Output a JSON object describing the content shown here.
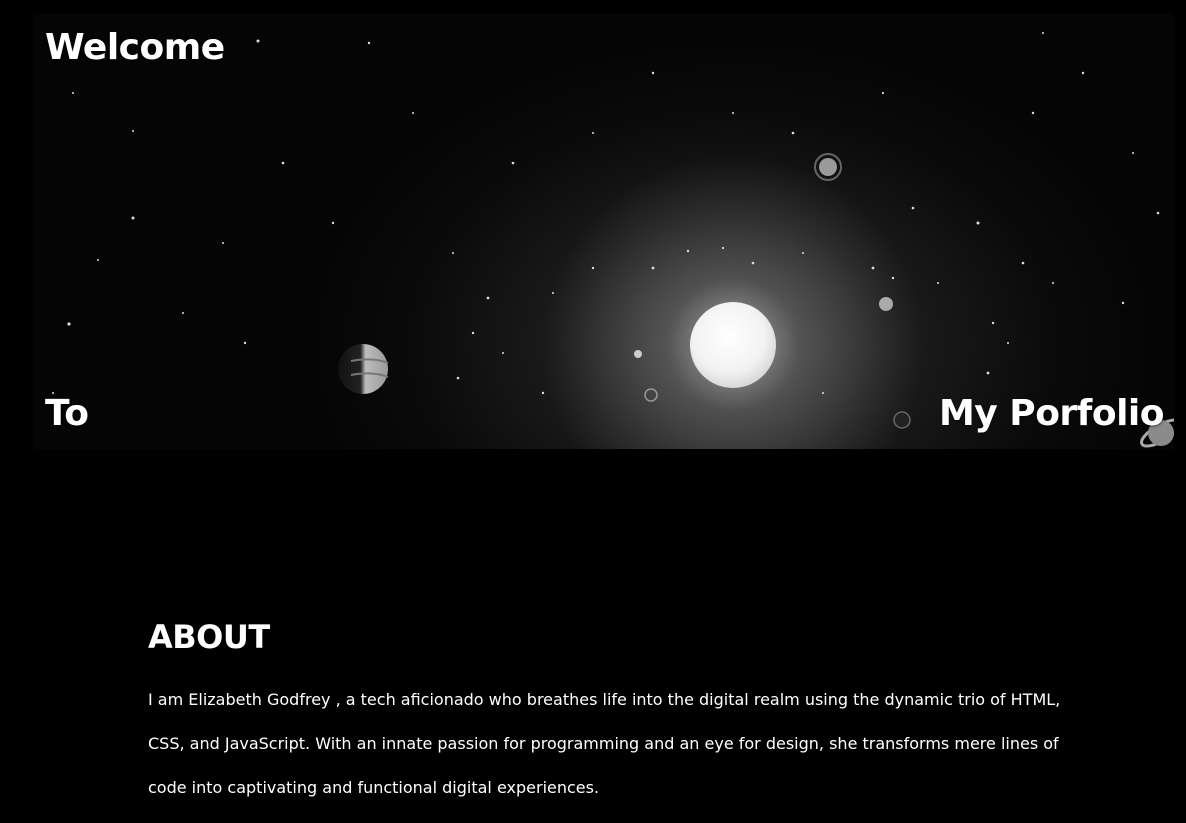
{
  "hero": {
    "word1": "Welcome",
    "word2": "To",
    "word3": "My Porfolio",
    "background": "space-scene-image"
  },
  "about": {
    "heading": "ABOUT",
    "text": "I am Elizabeth Godfrey , a tech aficionado who breathes life into the digital realm using the dynamic trio of HTML, CSS, and JavaScript. With an innate passion for programming and an eye for design, she transforms mere lines of code into captivating and functional digital experiences."
  },
  "colors": {
    "background": "#000000",
    "text": "#ffffff"
  }
}
